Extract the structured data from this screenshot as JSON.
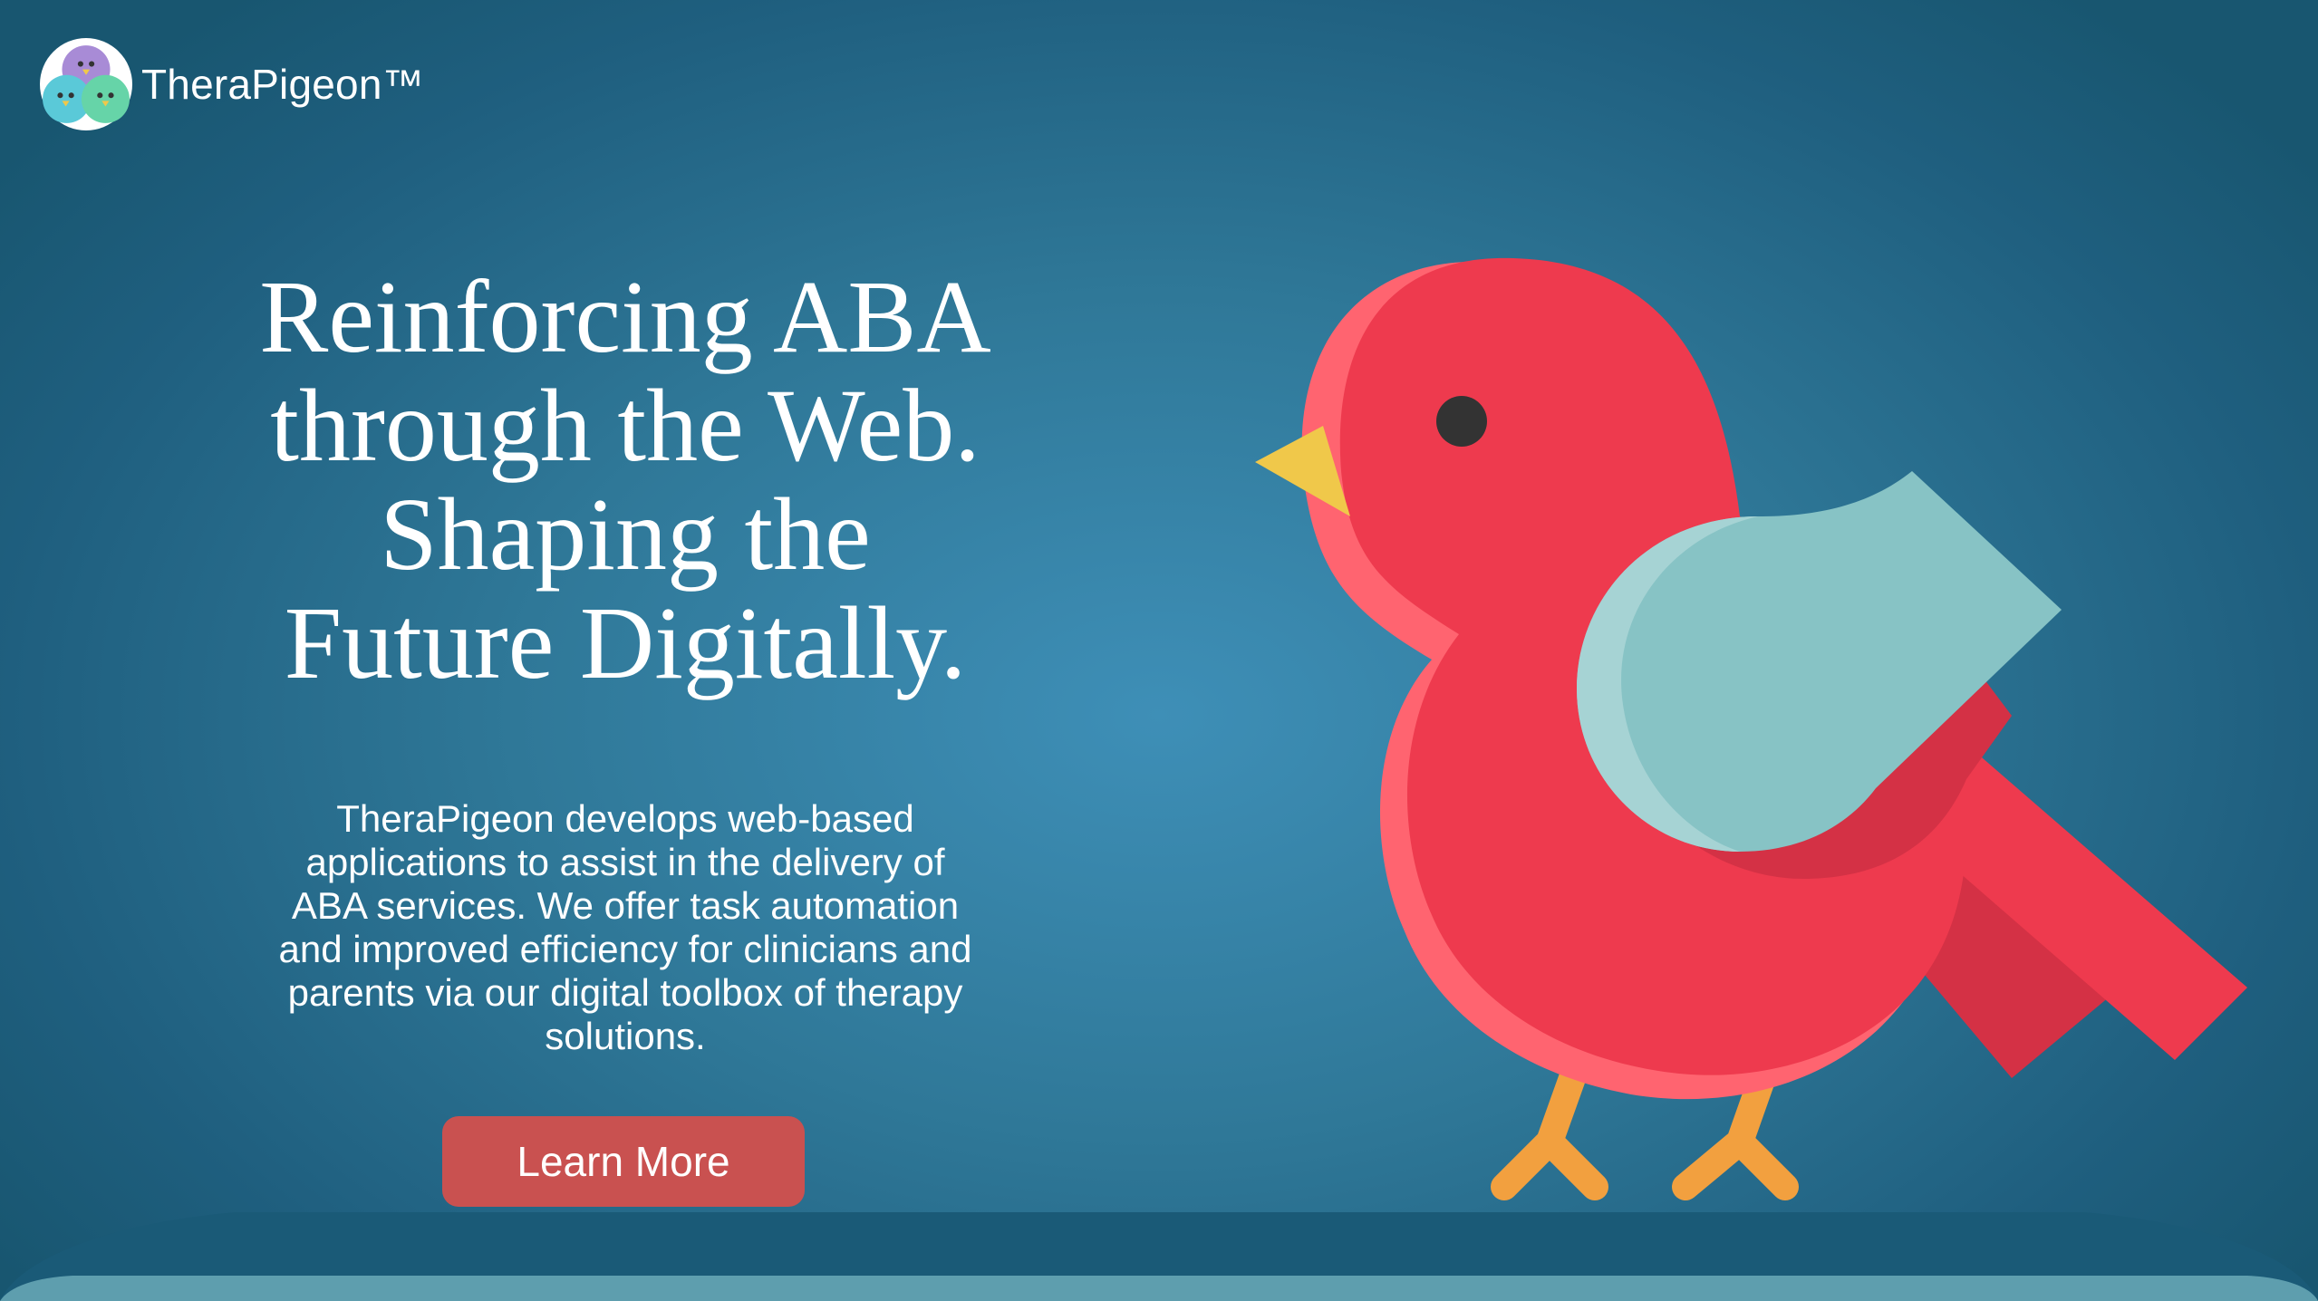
{
  "header": {
    "brand_name": "TheraPigeon™",
    "logo_icon": "three-birds-logo-icon"
  },
  "hero": {
    "headline_lines": [
      "Reinforcing ABA",
      "through the Web.",
      "Shaping the",
      "Future Digitally."
    ],
    "description_lines": [
      "TheraPigeon develops web-based",
      "applications to assist in the delivery of",
      "ABA services. We offer task automation",
      "and improved efficiency for clinicians and",
      "parents via our digital toolbox of therapy",
      "solutions."
    ],
    "cta_label": "Learn More"
  },
  "illustration": {
    "icon": "red-bird-icon"
  },
  "colors": {
    "background": "#2f7898",
    "background_center": "#3e8fb7",
    "bird_body": "#ee3a4e",
    "bird_shade": "#ff6470",
    "wing": "#87c3c5",
    "beak": "#f0c84a",
    "legs": "#f2a03f",
    "cta": "#c95150",
    "text": "#ffffff"
  }
}
